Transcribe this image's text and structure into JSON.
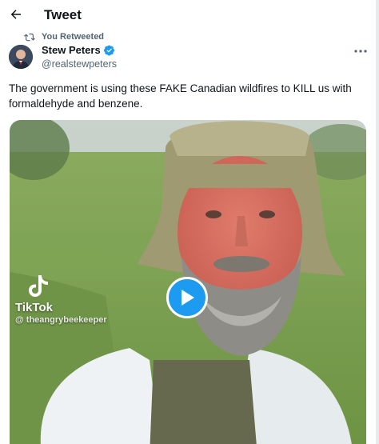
{
  "header": {
    "title": "Tweet",
    "back_icon": "arrow-left-icon"
  },
  "retweet": {
    "label": "You Retweeted",
    "icon": "retweet-icon"
  },
  "author": {
    "name": "Stew Peters",
    "handle": "@realstewpeters",
    "verified_icon": "verified-badge-icon"
  },
  "tweet": {
    "text": "The government is using these FAKE Canadian wildfires to KILL us with formaldehyde and benzene."
  },
  "video": {
    "watermark_brand": "TikTok",
    "watermark_user": "@ theangrybeekeeper",
    "play_icon": "play-icon"
  },
  "colors": {
    "accent": "#1d9bf0",
    "secondary_text": "#536471",
    "primary_text": "#0f1419"
  }
}
